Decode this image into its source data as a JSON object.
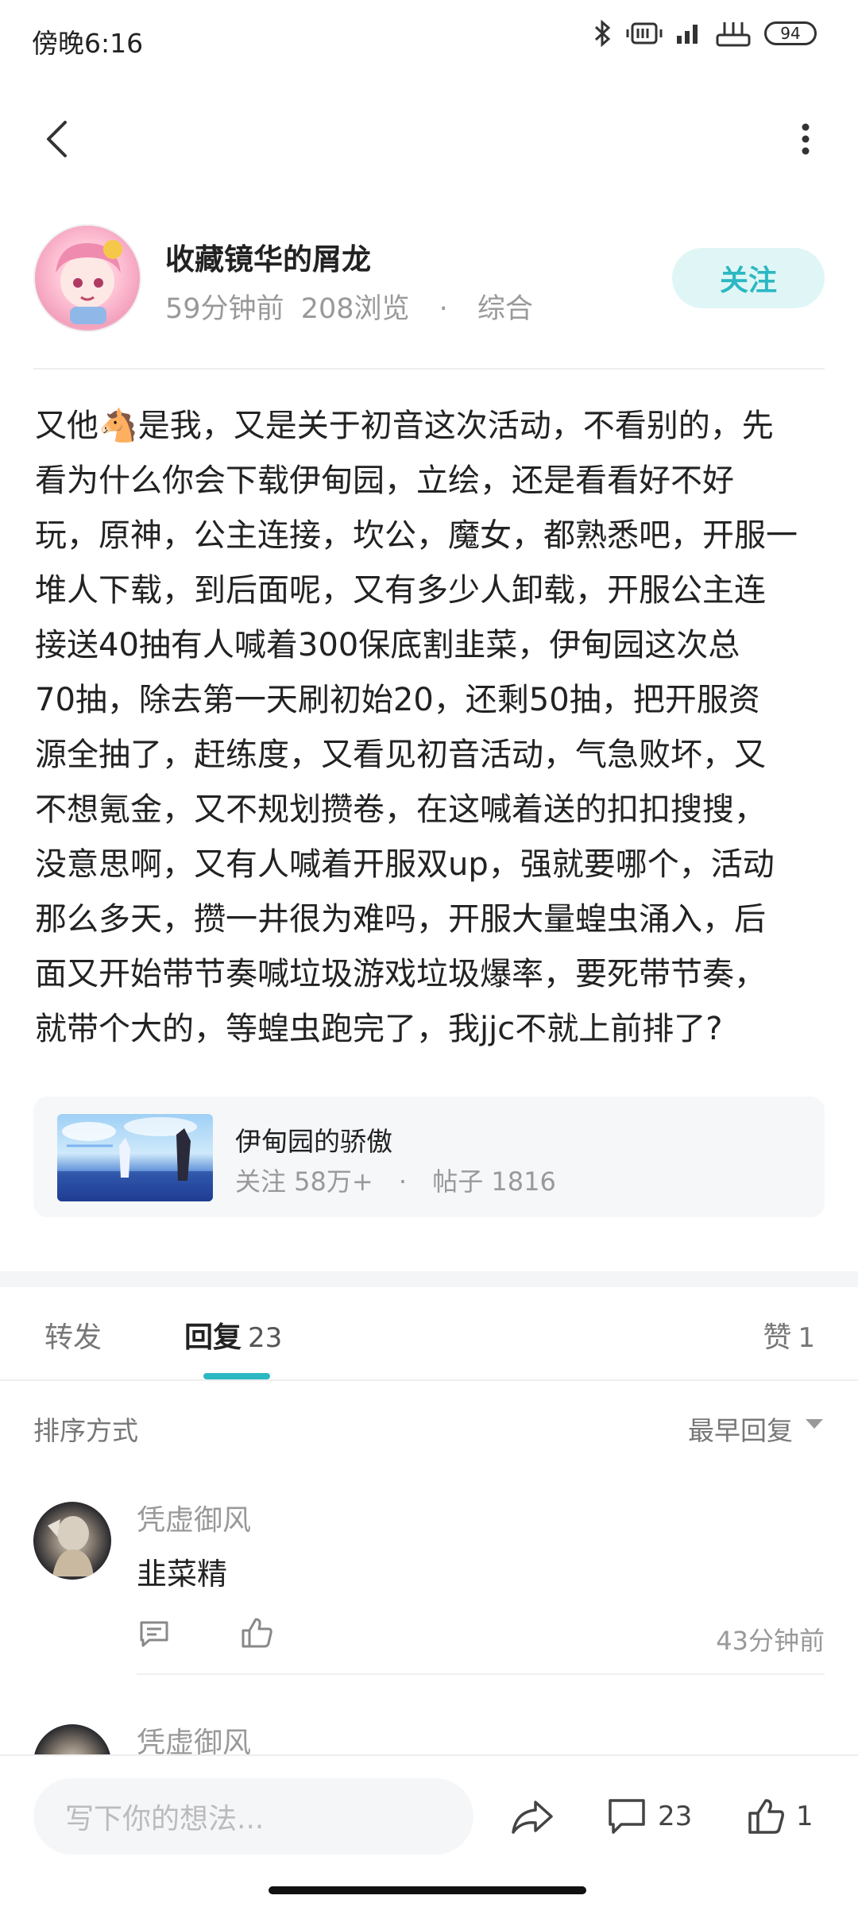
{
  "status_bar": {
    "time": "傍晚6:16",
    "battery": "94"
  },
  "author": {
    "name": "收藏镜华的屑龙",
    "time_ago": "59分钟前",
    "views": "208浏览",
    "separator": "·",
    "category": "综合",
    "follow_label": "关注"
  },
  "post": {
    "lines": [
      "又他🐴是我，又是关于初音这次活动，不看别的，先",
      "看为什么你会下载伊甸园，立绘，还是看看好不好",
      "玩，原神，公主连接，坎公，魔女，都熟悉吧，开服一",
      "堆人下载，到后面呢，又有多少人卸载，开服公主连",
      "接送40抽有人喊着300保底割韭菜，伊甸园这次总",
      "70抽，除去第一天刷初始20，还剩50抽，把开服资",
      "源全抽了，赶练度，又看见初音活动，气急败坏，又",
      "不想氪金，又不规划攒卷，在这喊着送的扣扣搜搜，",
      "没意思啊，又有人喊着开服双up，强就要哪个，活动",
      "那么多天，攒一井很为难吗，开服大量蝗虫涌入，后",
      "面又开始带节奏喊垃圾游戏垃圾爆率，要死带节奏，",
      "就带个大的，等蝗虫跑完了，我jjc不就上前排了?"
    ]
  },
  "forum": {
    "name": "伊甸园的骄傲",
    "followers": "关注 58万+",
    "separator": "·",
    "posts": "帖子 1816"
  },
  "tabs": {
    "forward": "转发",
    "reply": "回复",
    "reply_count": "23",
    "like": "赞",
    "like_count": "1"
  },
  "sort": {
    "label": "排序方式",
    "value": "最早回复"
  },
  "comments": [
    {
      "user": "凭虚御风",
      "text": "韭菜精",
      "time": "43分钟前"
    },
    {
      "user": "凭虚御风",
      "text": "",
      "time": ""
    }
  ],
  "bottom_bar": {
    "input_placeholder": "写下你的想法...",
    "comment_count": "23",
    "like_count": "1"
  },
  "colors": {
    "accent": "#2cb8c2",
    "follow_bg": "#e0f6f6"
  }
}
